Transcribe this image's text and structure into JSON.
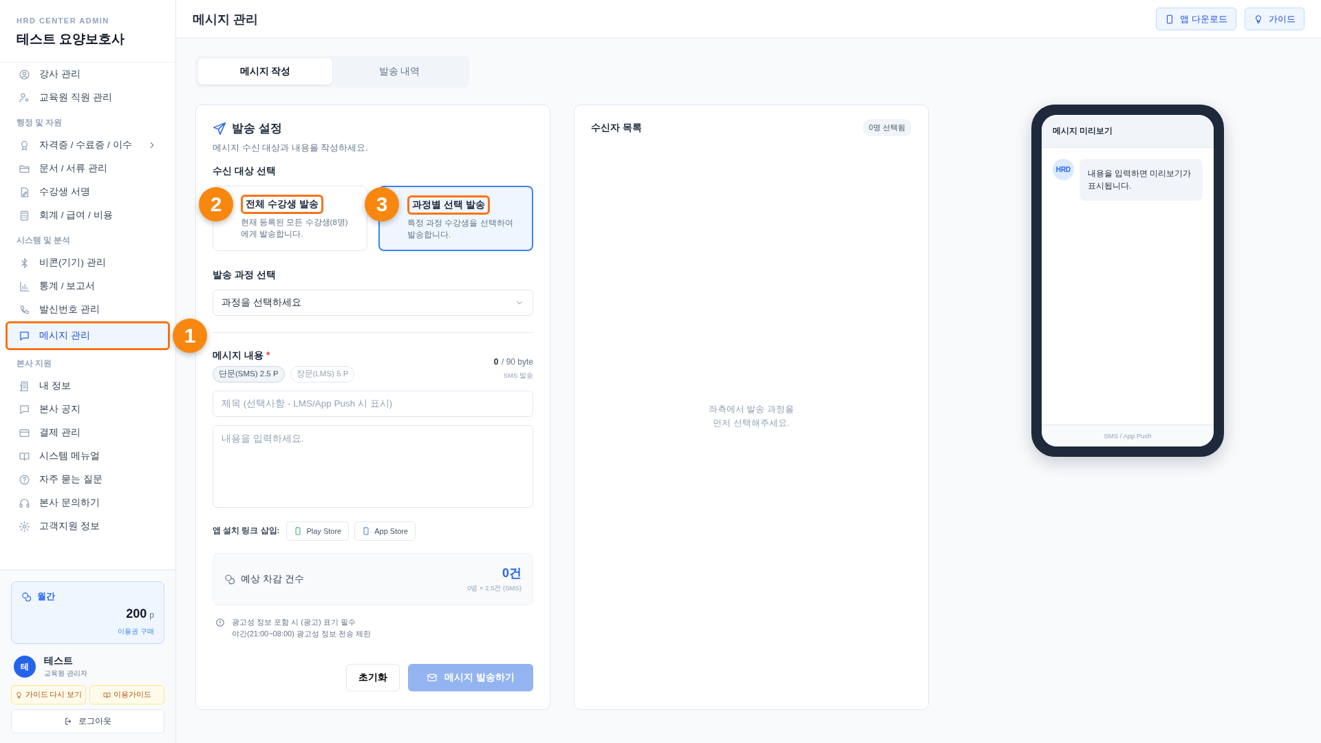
{
  "sidebar": {
    "brand_caption": "HRD CENTER ADMIN",
    "brand_title": "테스트 요양보호사",
    "nav": [
      {
        "kind": "item",
        "label": "강사 관리",
        "selected": false,
        "highlighted": false,
        "submenu": false
      },
      {
        "kind": "item",
        "label": "교육원 직원 관리",
        "selected": false,
        "highlighted": false,
        "submenu": false
      },
      {
        "kind": "heading",
        "label": "행정 및 자원"
      },
      {
        "kind": "item",
        "label": "자격증 / 수료증 / 이수",
        "selected": false,
        "highlighted": false,
        "submenu": true
      },
      {
        "kind": "item",
        "label": "문서 / 서류 관리",
        "selected": false,
        "highlighted": false,
        "submenu": false
      },
      {
        "kind": "item",
        "label": "수강생 서명",
        "selected": false,
        "highlighted": false,
        "submenu": false
      },
      {
        "kind": "item",
        "label": "회계 / 급여 / 비용",
        "selected": false,
        "highlighted": false,
        "submenu": false
      },
      {
        "kind": "heading",
        "label": "시스템 및 분석"
      },
      {
        "kind": "item",
        "label": "비콘(기기) 관리",
        "selected": false,
        "highlighted": false,
        "submenu": false
      },
      {
        "kind": "item",
        "label": "통계 / 보고서",
        "selected": false,
        "highlighted": false,
        "submenu": false
      },
      {
        "kind": "item",
        "label": "발신번호 관리",
        "selected": false,
        "highlighted": false,
        "submenu": false
      },
      {
        "kind": "item",
        "label": "메시지 관리",
        "selected": true,
        "highlighted": true,
        "submenu": false,
        "guide_marker": "1"
      },
      {
        "kind": "heading",
        "label": "본사 지원"
      },
      {
        "kind": "item",
        "label": "내 정보",
        "selected": false,
        "highlighted": false,
        "submenu": false
      },
      {
        "kind": "item",
        "label": "본사 공지",
        "selected": false,
        "highlighted": false,
        "submenu": false
      },
      {
        "kind": "item",
        "label": "결제 관리",
        "selected": false,
        "highlighted": false,
        "submenu": false
      },
      {
        "kind": "item",
        "label": "시스템 메뉴얼",
        "selected": false,
        "highlighted": false,
        "submenu": false
      },
      {
        "kind": "item",
        "label": "자주 묻는 질문",
        "selected": false,
        "highlighted": false,
        "submenu": false
      },
      {
        "kind": "item",
        "label": "본사 문의하기",
        "selected": false,
        "highlighted": false,
        "submenu": false
      },
      {
        "kind": "item",
        "label": "고객지원 정보",
        "selected": false,
        "highlighted": false,
        "submenu": false
      }
    ],
    "plan": {
      "label": "월간",
      "amount": "200",
      "unit": "p",
      "link": "이용권 구매"
    },
    "user": {
      "initial": "테",
      "name": "테스트",
      "role": "교육원 관리자"
    },
    "guide_buttons": [
      "가이드 다시 보기",
      "이용가이드"
    ],
    "logout": "로그아웃"
  },
  "header": {
    "title": "메시지 관리",
    "buttons": [
      "앱 다운로드",
      "가이드"
    ]
  },
  "tabs": [
    {
      "label": "메시지 작성",
      "selected": true
    },
    {
      "label": "발송 내역",
      "selected": false
    }
  ],
  "settings": {
    "title": "발송 설정",
    "subtitle": "메시지 수신 대상과 내용을 작성하세요.",
    "target_heading": "수신 대상 선택",
    "options": [
      {
        "title": "전체 수강생 발송",
        "description": "현재 등록된 모든 수강생(8명) 에게 발송합니다.",
        "selected": false,
        "highlighted": true,
        "guide_marker": "2"
      },
      {
        "title": "과정별 선택 발송",
        "description": "특정 과정 수강생을 선택하여 발송합니다.",
        "selected": true,
        "highlighted": true,
        "guide_marker": "3"
      }
    ],
    "course_heading": "발송 과정 선택",
    "course_select": "과정을 선택하세요",
    "content_label": "메시지 내용",
    "required_mark": "*",
    "types": [
      {
        "label": "단문(SMS) 2.5 P",
        "selected": true
      },
      {
        "label": "장문(LMS) 5 P",
        "selected": false
      }
    ],
    "byte_count": "0",
    "byte_limit": "/ 90 byte",
    "send_mode": "SMS 발송",
    "subject_placeholder": "제목 (선택사항 - LMS/App Push 시 표시)",
    "body_placeholder": "내용을 입력하세요.",
    "link_label": "앱 설치 링크 삽입:",
    "link_buttons": [
      "Play Store",
      "App Store"
    ],
    "estimate": {
      "label": "예상 차감 건수",
      "value": "0건",
      "formula": "0명 × 2.5건 (SMS)"
    },
    "notices": [
      "광고성 정보 포함 시 (광고) 표기 필수",
      "야간(21:00~08:00) 광고성 정보 전송 제한"
    ],
    "reset": "초기화",
    "send": "메시지 발송하기",
    "send_disabled": true
  },
  "recipients": {
    "title": "수신자 목록",
    "badge": "0명 선택됨",
    "empty": [
      "좌측에서 발송 과정을",
      "먼저 선택해주세요."
    ]
  },
  "preview": {
    "title": "메시지 미리보기",
    "avatar": "HRD",
    "bubble": "내용을 입력하면 미리보기가 표시됩니다.",
    "footer": "SMS / App Push"
  }
}
